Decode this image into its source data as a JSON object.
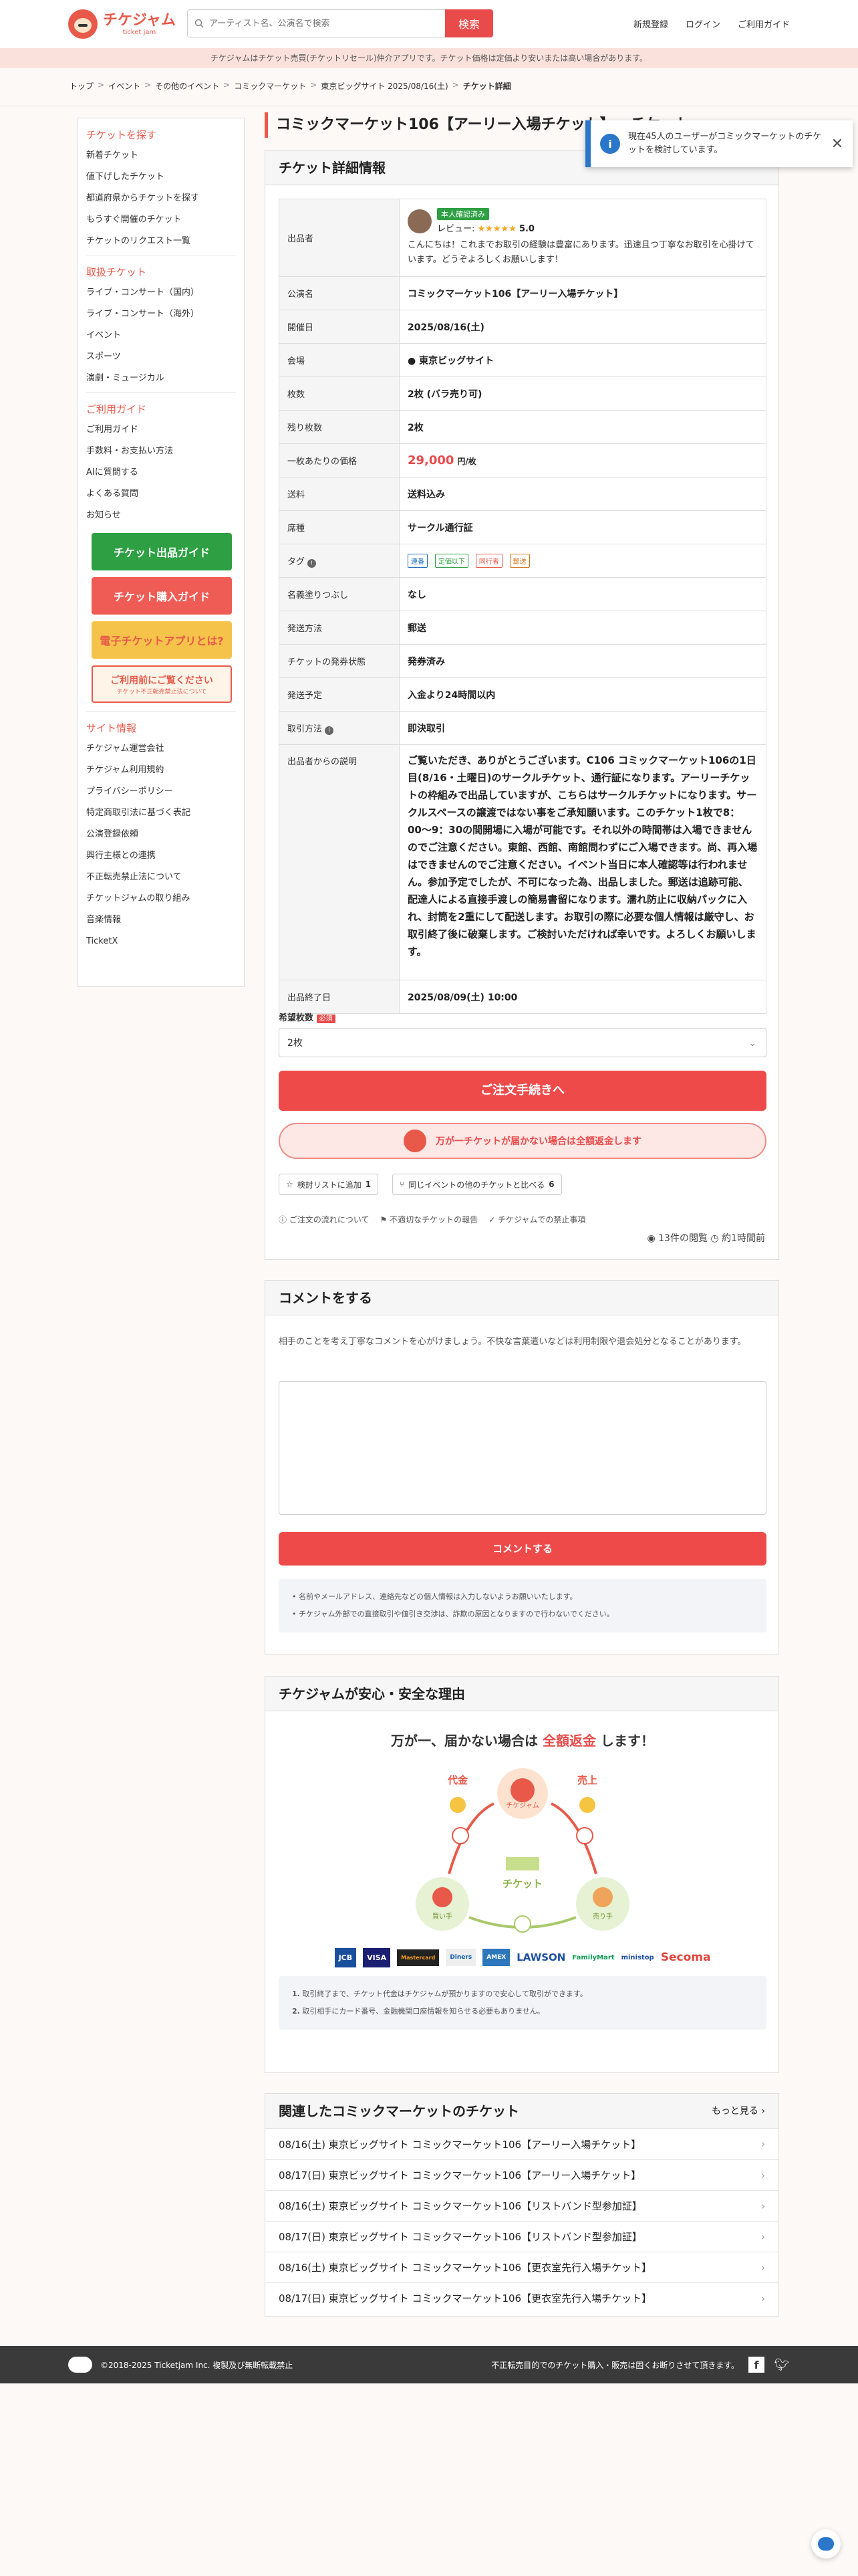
{
  "header": {
    "logo_text": "チケジャム",
    "logo_sub": "ticket jam",
    "search_placeholder": "アーティスト名、公演名で検索",
    "search_button": "検索",
    "nav": [
      "新規登録",
      "ログイン",
      "ご利用ガイド"
    ]
  },
  "notice": "チケジャムはチケット売買(チケットリセール)仲介アプリです。チケット価格は定価より安いまたは高い場合があります。",
  "breadcrumb": [
    "トップ",
    "イベント",
    "その他のイベント",
    "コミックマーケット",
    "東京ビッグサイト 2025/08/16(土)",
    "チケット詳細"
  ],
  "sidebar": {
    "find_heading": "チケットを探す",
    "find_items": [
      "新着チケット",
      "値下げしたチケット",
      "都道府県からチケットを探す",
      "もうすぐ開催のチケット",
      "チケットのリクエスト一覧"
    ],
    "genre_heading": "取扱チケット",
    "genre_items": [
      "ライブ・コンサート（国内）",
      "ライブ・コンサート（海外）",
      "イベント",
      "スポーツ",
      "演劇・ミュージカル"
    ],
    "guide_heading": "ご利用ガイド",
    "guide_items": [
      "ご利用ガイド",
      "手数料・お支払い方法",
      "AIに質問する",
      "よくある質問",
      "お知らせ"
    ],
    "banners": [
      "チケット出品ガイド",
      "チケット購入ガイド",
      "電子チケットアプリとは?",
      "ご利用前にご覧ください"
    ],
    "banner_sub": "チケット不正転売禁止法について",
    "site_heading": "サイト情報",
    "site_items": [
      "チケジャム運営会社",
      "チケジャム利用規約",
      "プライバシーポリシー",
      "特定商取引法に基づく表記",
      "公演登録依頼",
      "興行主様との連携",
      "不正転売禁止法について",
      "チケットジャムの取り組み",
      "音楽情報",
      "TicketX"
    ]
  },
  "page_title": "コミックマーケット106【アーリー入場チケット】 - チケット",
  "toast": {
    "text": "現在45人のユーザーがコミックマーケットのチケットを検討しています。"
  },
  "detail": {
    "heading": "チケット詳細情報",
    "seller_label": "出品者",
    "seller_badge": "本人確認済み",
    "seller_review_label": "レビュー:",
    "seller_stars": "★★★★★",
    "seller_score": "5.0",
    "seller_message": "こんにちは！これまでお取引の経験は豊富にあります。迅速且つ丁寧なお取引を心掛けています。どうぞよろしくお願いします！",
    "rows": [
      {
        "k": "公演名",
        "v": "コミックマーケット106【アーリー入場チケット】"
      },
      {
        "k": "開催日",
        "v": "2025/08/16(土)"
      },
      {
        "k": "会場",
        "v": "東京ビッグサイト"
      },
      {
        "k": "枚数",
        "v": "2枚 (バラ売り可)"
      },
      {
        "k": "残り枚数",
        "v": "2枚"
      },
      {
        "k": "一枚あたりの価格",
        "v": "29,000",
        "unit": "円/枚"
      },
      {
        "k": "送料",
        "v": "送料込み"
      },
      {
        "k": "席種",
        "v": "サークル通行証"
      },
      {
        "k": "タグ",
        "v": ""
      },
      {
        "k": "名義塗りつぶし",
        "v": "なし"
      },
      {
        "k": "発送方法",
        "v": "郵送"
      },
      {
        "k": "チケットの発券状態",
        "v": "発券済み"
      },
      {
        "k": "発送予定",
        "v": "入金より24時間以内"
      },
      {
        "k": "取引方法",
        "v": "即決取引"
      }
    ],
    "tags": [
      "連番",
      "定価以下",
      "同行者",
      "郵送"
    ],
    "desc_label": "出品者からの説明",
    "description": "ご覧いただき、ありがとうございます。C106 コミックマーケット106の1日目(8/16・土曜日)のサークルチケット、通行証になります。アーリーチケットの枠組みで出品していますが、こちらはサークルチケットになります。サークルスペースの譲渡ではない事をご承知願います。このチケット1枚で8：00〜9：30の間開場に入場が可能です。それ以外の時間帯は入場できませんのでご注意ください。東館、西館、南館問わずにご入場できます。尚、再入場はできませんのでご注意ください。イベント当日に本人確認等は行われません。参加予定でしたが、不可になった為、出品しました。郵送は追跡可能、配達人による直接手渡しの簡易書留になります。濡れ防止に収納パックに入れ、封筒を2重にして配送します。お取引の際に必要な個人情報は厳守し、お取引終了後に破棄します。ご検討いただければ幸いです。よろしくお願いします。",
    "end_label": "出品終了日",
    "end_value": "2025/08/09(土) 10:00",
    "qty_label": "希望枚数",
    "qty_required": "必須",
    "qty_value": "2枚",
    "order_button": "ご注文手続きへ",
    "refund_text": "万が一チケットが届かない場合は全額返金します",
    "fav_button": "検討リストに追加",
    "fav_count": "1",
    "compare_button": "同じイベントの他のチケットと比べる",
    "compare_count": "6",
    "links": [
      "ご注文の流れについて",
      "不適切なチケットの報告",
      "チケジャムでの禁止事項"
    ],
    "views": "13件の閲覧",
    "posted": "約1時間前"
  },
  "comment": {
    "heading": "コメントをする",
    "intro": "相手のことを考え丁寧なコメントを心がけましょう。不快な言葉遣いなどは利用制限や退会処分となることがあります。",
    "button": "コメントする",
    "notes": [
      "名前やメールアドレス、連絡先などの個人情報は入力しないようお願いいたします。",
      "チケジャム外部での直接取引や値引き交渉は、詐欺の原因となりますので行わないでください。"
    ]
  },
  "safety": {
    "heading": "チケジャムが安心・安全な理由",
    "headline_a": "万が一、届かない場合は",
    "headline_b": "全額返金",
    "headline_c": "します！",
    "diagram": {
      "money": "代金",
      "sales": "売上",
      "center": "チケジャム",
      "ticket": "チケット",
      "buyer": "買い手",
      "seller": "売り手"
    },
    "payments": [
      "JCB",
      "VISA",
      "Mastercard",
      "Diners",
      "AMEX",
      "LAWSON",
      "FamilyMart",
      "ministop",
      "Secoma"
    ],
    "notes": [
      "取引終了まで、チケット代金はチケジャムが預かりますので安心して取引ができます。",
      "取引相手にカード番号、金融機関口座情報を知らせる必要もありません。"
    ]
  },
  "related": {
    "heading": "関連したコミックマーケットのチケット",
    "more": "もっと見る",
    "items": [
      "08/16(土) 東京ビッグサイト コミックマーケット106【アーリー入場チケット】",
      "08/17(日) 東京ビッグサイト コミックマーケット106【アーリー入場チケット】",
      "08/16(土) 東京ビッグサイト コミックマーケット106【リストバンド型参加証】",
      "08/17(日) 東京ビッグサイト コミックマーケット106【リストバンド型参加証】",
      "08/16(土) 東京ビッグサイト コミックマーケット106【更衣室先行入場チケット】",
      "08/17(日) 東京ビッグサイト コミックマーケット106【更衣室先行入場チケット】"
    ]
  },
  "footer": {
    "copyright": "©2018-2025 Ticketjam Inc. 複製及び無断転載禁止",
    "notice": "不正転売目的でのチケット購入・販売は固くお断りさせて頂きます。"
  },
  "colors": {
    "accent": "#e8594a",
    "button": "#ef4a4a",
    "link": "#1e6fbf",
    "notice_bg": "#fbe1dc"
  }
}
